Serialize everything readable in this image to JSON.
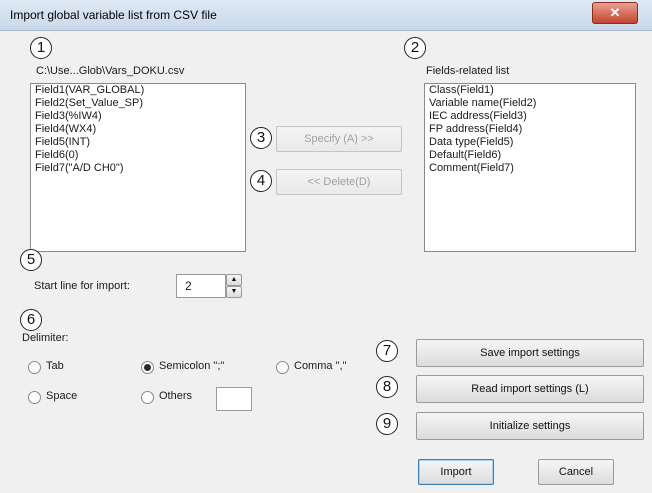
{
  "window": {
    "title": "Import global variable list from CSV file",
    "close_glyph": "✕"
  },
  "markers": [
    "1",
    "2",
    "3",
    "4",
    "5",
    "6",
    "7",
    "8",
    "9"
  ],
  "csv": {
    "path": "C:\\Use...Glob\\Vars_DOKU.csv",
    "fields": [
      "Field1(VAR_GLOBAL)",
      "Field2(Set_Value_SP)",
      "Field3(%IW4)",
      "Field4(WX4)",
      "Field5(INT)",
      "Field6(0)",
      "Field7(\"A/D CH0\")"
    ]
  },
  "related": {
    "label": "Fields-related list",
    "items": [
      "Class(Field1)",
      "Variable name(Field2)",
      "IEC address(Field3)",
      "FP address(Field4)",
      "Data type(Field5)",
      "Default(Field6)",
      "Comment(Field7)"
    ]
  },
  "buttons": {
    "specify": "Specify (A) >>",
    "delete": "<< Delete(D)",
    "save": "Save import settings",
    "read": "Read import settings (L)",
    "init": "Initialize settings",
    "import": "Import",
    "cancel": "Cancel"
  },
  "start_line": {
    "label": "Start line for import:",
    "value": "2"
  },
  "delimiter": {
    "label": "Delimiter:",
    "options": {
      "tab": "Tab",
      "semicolon": "Semicolon \";\"",
      "comma": "Comma \",\"",
      "space": "Space",
      "others": "Others"
    },
    "selected": "semicolon",
    "others_value": ""
  }
}
